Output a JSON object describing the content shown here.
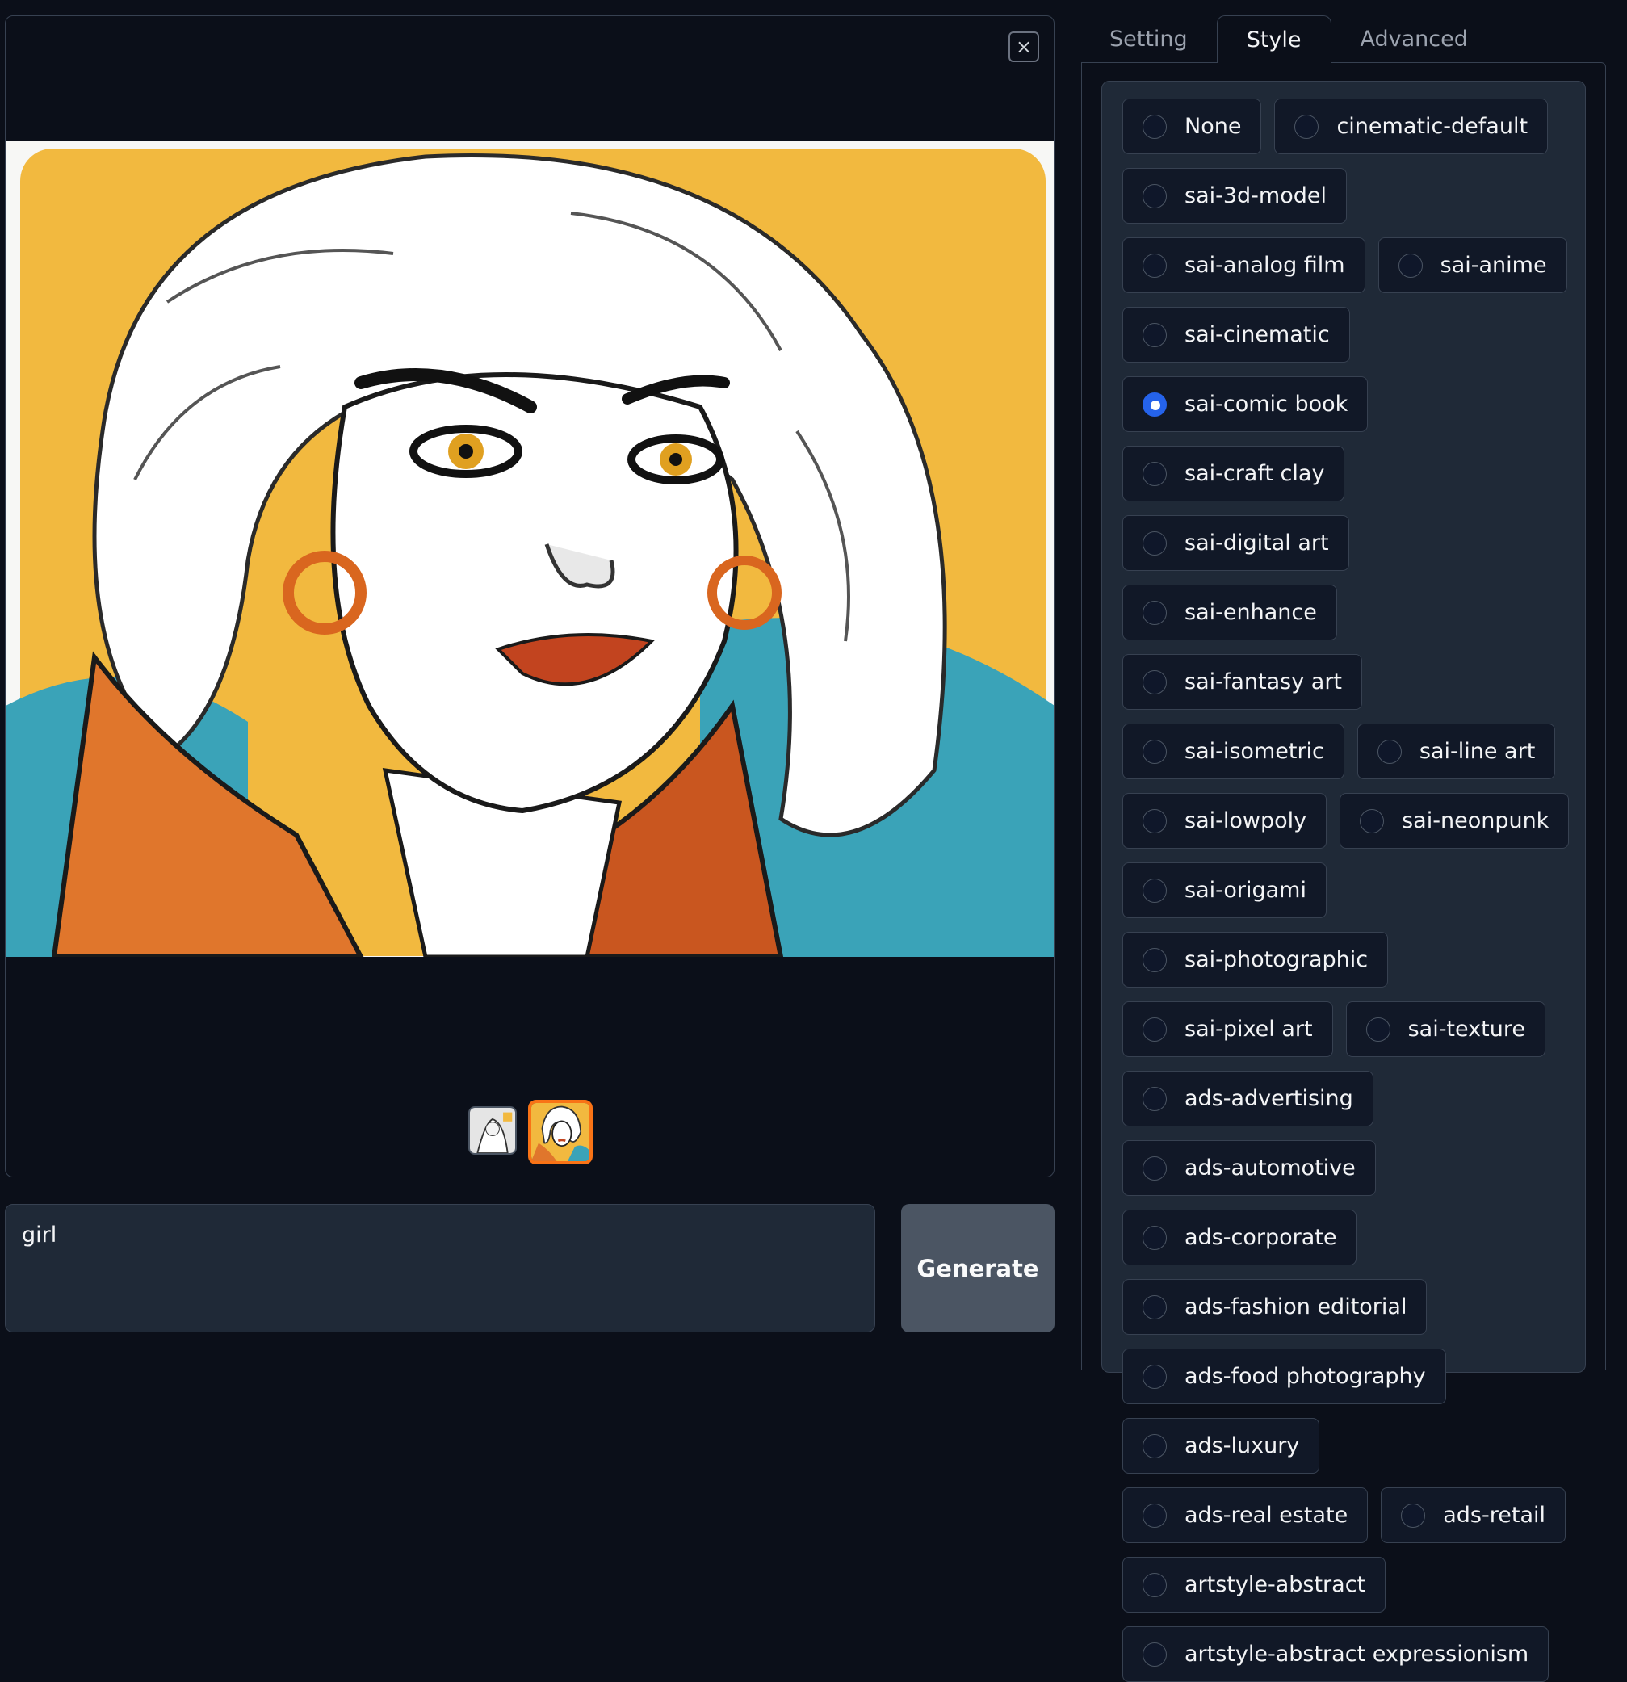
{
  "gallery": {
    "close_symbol": "×",
    "main_image_alt": "comic book style portrait",
    "thumbnails": [
      "thumbnail-1",
      "thumbnail-2"
    ],
    "selected_thumbnail": 2
  },
  "prompt": {
    "value": "girl"
  },
  "generate_label": "Generate",
  "tabs": [
    {
      "label": "Setting",
      "active": false
    },
    {
      "label": "Style",
      "active": true
    },
    {
      "label": "Advanced",
      "active": false
    }
  ],
  "styles": {
    "selected": "sai-comic book",
    "items": [
      "None",
      "cinematic-default",
      "sai-3d-model",
      "sai-analog film",
      "sai-anime",
      "sai-cinematic",
      "sai-comic book",
      "sai-craft clay",
      "sai-digital art",
      "sai-enhance",
      "sai-fantasy art",
      "sai-isometric",
      "sai-line art",
      "sai-lowpoly",
      "sai-neonpunk",
      "sai-origami",
      "sai-photographic",
      "sai-pixel art",
      "sai-texture",
      "ads-advertising",
      "ads-automotive",
      "ads-corporate",
      "ads-fashion editorial",
      "ads-food photography",
      "ads-luxury",
      "ads-real estate",
      "ads-retail",
      "artstyle-abstract",
      "artstyle-abstract expressionism"
    ]
  },
  "colors": {
    "background": "#0b0f19",
    "panel": "#1f2937",
    "accent_selected_thumb": "#f97316",
    "radio_checked": "#2563eb"
  }
}
